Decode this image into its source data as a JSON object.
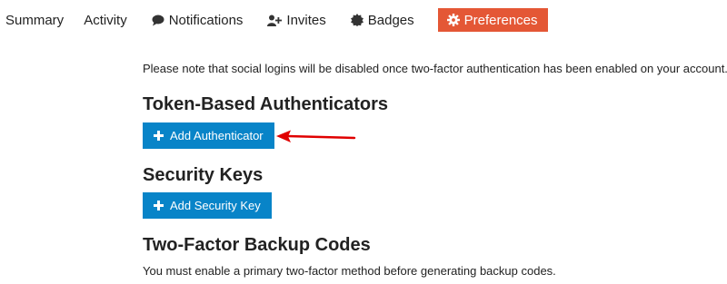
{
  "nav": {
    "items": [
      {
        "label": "Summary",
        "icon": null,
        "active": false
      },
      {
        "label": "Activity",
        "icon": null,
        "active": false
      },
      {
        "label": "Notifications",
        "icon": "comment-icon",
        "active": false
      },
      {
        "label": "Invites",
        "icon": "user-plus-icon",
        "active": false
      },
      {
        "label": "Badges",
        "icon": "badge-icon",
        "active": false
      },
      {
        "label": "Preferences",
        "icon": "gear-icon",
        "active": true
      }
    ],
    "active_color": "#e45735"
  },
  "main": {
    "notice": "Please note that social logins will be disabled once two-factor authentication has been enabled on your account.",
    "sections": [
      {
        "title": "Token-Based Authenticators",
        "button_label": "Add Authenticator",
        "button_icon": "plus-icon"
      },
      {
        "title": "Security Keys",
        "button_label": "Add Security Key",
        "button_icon": "plus-icon"
      },
      {
        "title": "Two-Factor Backup Codes",
        "text": "You must enable a primary two-factor method before generating backup codes."
      }
    ],
    "button_color": "#0884c8",
    "annotation_arrow_color": "#e00000"
  }
}
